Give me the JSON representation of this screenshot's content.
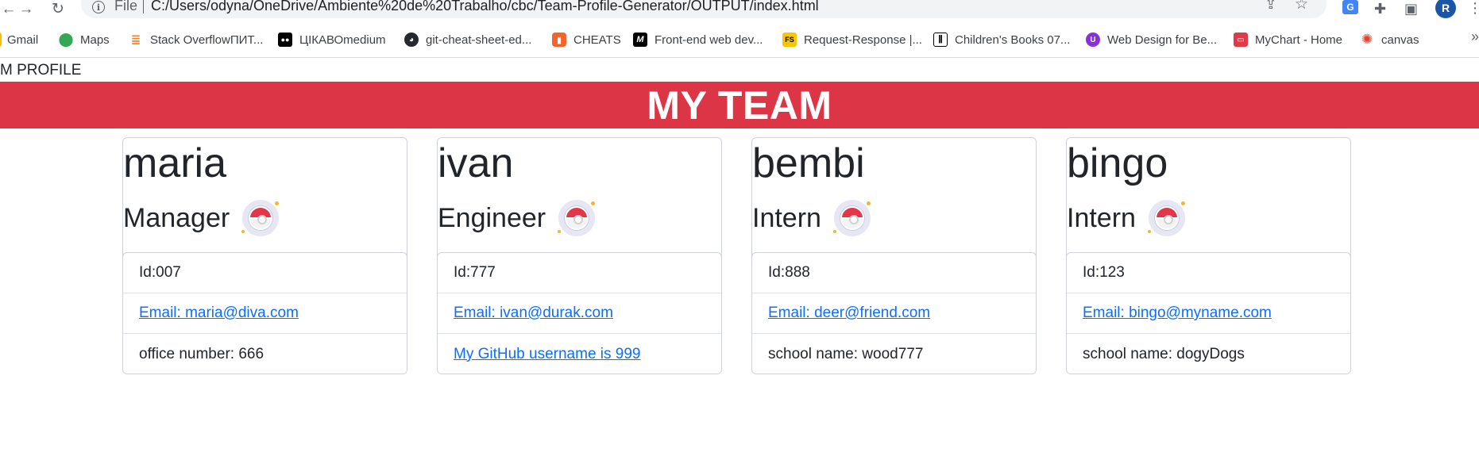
{
  "browser": {
    "scheme_label": "File",
    "url": "C:/Users/odyna/OneDrive/Ambiente%20de%20Trabalho/cbc/Team-Profile-Generator/OUTPUT/index.html",
    "profile_initial": "R",
    "bookmarks": [
      {
        "label": "Gmail",
        "icon": "gmail-icon"
      },
      {
        "label": "Maps",
        "icon": "maps-icon"
      },
      {
        "label": "Stack OverflowПИТ...",
        "icon": "stackoverflow-icon"
      },
      {
        "label": "ЦІКАВОmedium",
        "icon": "medium-icon"
      },
      {
        "label": "git-cheat-sheet-ed...",
        "icon": "github-icon"
      },
      {
        "label": "CHEATS",
        "icon": "cheats-icon"
      },
      {
        "label": "Front-end web dev...",
        "icon": "frontend-icon"
      },
      {
        "label": "Request-Response |...",
        "icon": "request-response-icon"
      },
      {
        "label": "Children's Books 07...",
        "icon": "library-icon"
      },
      {
        "label": "Web Design for Be...",
        "icon": "webdesign-icon"
      },
      {
        "label": "MyChart - Home",
        "icon": "mychart-icon"
      },
      {
        "label": "canvas",
        "icon": "canvas-icon"
      }
    ]
  },
  "page": {
    "doc_title": "M PROFILE",
    "banner": "MY TEAM"
  },
  "team": [
    {
      "name": "maria",
      "role": "Manager",
      "id": "Id:007",
      "email": "Email: maria@diva.com",
      "extra": "office number: 666",
      "extra_is_link": false
    },
    {
      "name": "ivan",
      "role": "Engineer",
      "id": "Id:777",
      "email": "Email: ivan@durak.com",
      "extra": "My GitHub username is 999",
      "extra_is_link": true
    },
    {
      "name": "bembi",
      "role": "Intern",
      "id": "Id:888",
      "email": "Email: deer@friend.com",
      "extra": "school name: wood777",
      "extra_is_link": false
    },
    {
      "name": "bingo",
      "role": "Intern",
      "id": "Id:123",
      "email": "Email: bingo@myname.com",
      "extra": "school name: dogyDogs",
      "extra_is_link": false
    }
  ]
}
